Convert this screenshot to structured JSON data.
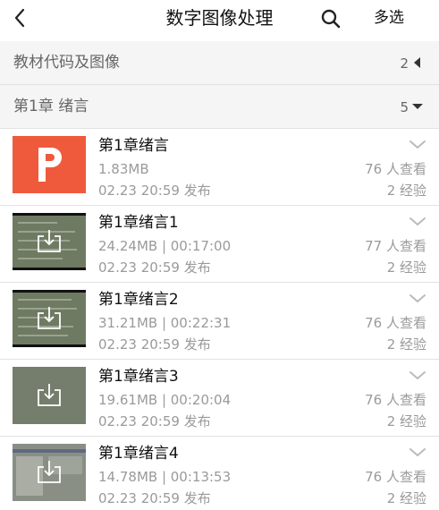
{
  "header": {
    "title": "数字图像处理",
    "back_icon": "chevron-left-icon",
    "search_icon": "search-icon",
    "multi_select_label": "多选"
  },
  "sections": [
    {
      "label": "教材代码及图像",
      "count": "2",
      "arrow_icon": "triangle-left-icon"
    },
    {
      "label": "第1章 绪言",
      "count": "5",
      "arrow_icon": "triangle-down-icon"
    }
  ],
  "items": [
    {
      "title": "第1章绪言",
      "meta": "1.83MB",
      "date": "02.23 20:59 发布",
      "views": "76 人查看",
      "exp": "2 经验",
      "thumb": "ppt-icon"
    },
    {
      "title": "第1章绪言1",
      "meta": "24.24MB | 00:17:00",
      "date": "02.23 20:59 发布",
      "views": "77 人查看",
      "exp": "2 经验",
      "thumb": "video-thumbnail"
    },
    {
      "title": "第1章绪言2",
      "meta": "31.21MB | 00:22:31",
      "date": "02.23 20:59 发布",
      "views": "76 人查看",
      "exp": "2 经验",
      "thumb": "video-thumbnail"
    },
    {
      "title": "第1章绪言3",
      "meta": "19.61MB | 00:20:04",
      "date": "02.23 20:59 发布",
      "views": "76 人查看",
      "exp": "2 经验",
      "thumb": "video-thumbnail"
    },
    {
      "title": "第1章绪言4",
      "meta": "14.78MB | 00:13:53",
      "date": "02.23 20:59 发布",
      "views": "76 人查看",
      "exp": "2 经验",
      "thumb": "video-thumbnail"
    }
  ],
  "colors": {
    "ppt_orange": "#ef5a3c",
    "section_bg": "#f5f5f5",
    "meta_gray": "#9a9a9a"
  }
}
